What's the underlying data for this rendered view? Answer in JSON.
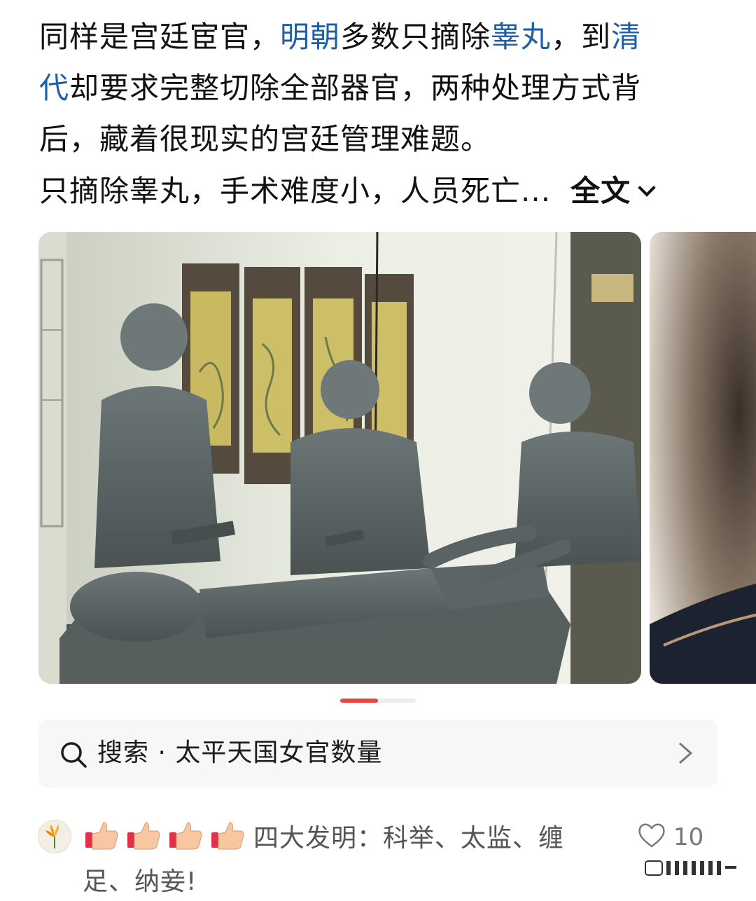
{
  "post": {
    "line1_a": "同样是宫廷宦官，",
    "line1_link1": "明朝",
    "line1_b": "多数只摘除",
    "line1_link2": "睾丸",
    "line1_c": "，到",
    "line1_link3": "清",
    "line2_link3": "代",
    "line2_rest": "却要求完整切除全部器官，两种处理方式背",
    "line3": "后，藏着很现实的宫廷管理难题。",
    "preview": "只摘除睾丸，手术难度小，人员死亡...",
    "full_text_label": "全文"
  },
  "carousel": {
    "images": [
      "clay-sculpture-eunuch-surgery-scene",
      "next-image-partial"
    ],
    "active_index": 0,
    "total": 2
  },
  "search": {
    "label": "搜索 · 太平天国女官数量"
  },
  "comment": {
    "text": "四大发明：科举、太监、缠足、纳妾!",
    "reaction_emoji_count": 4,
    "like_count": "10"
  },
  "colors": {
    "link": "#1f5fa8",
    "indicator_active": "#e8483f",
    "search_bg": "#f6f7f9"
  }
}
